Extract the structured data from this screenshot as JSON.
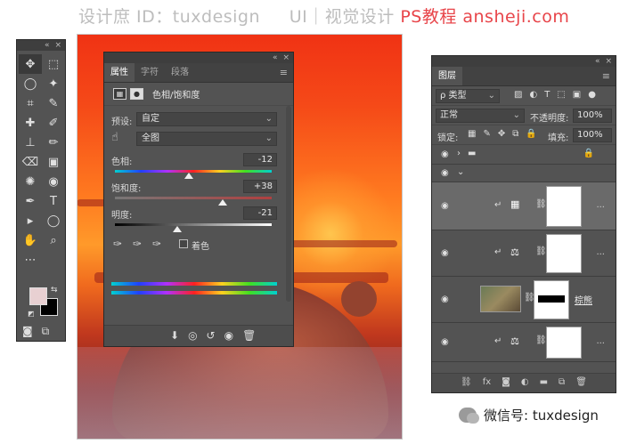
{
  "watermark": {
    "text": "设计庶 ID：tuxdesign",
    "brand": "UI｜视觉设计",
    "url": "PS教程 ansheji.com"
  },
  "toolbox": {
    "tools": [
      "✥",
      "⬚",
      "◯",
      "✦",
      "⌗",
      "✎",
      "✚",
      "✐",
      "⊥",
      "✏",
      "⌫",
      "▣",
      "✺",
      "◉",
      "✒",
      "T",
      "▸",
      "◯",
      "✋",
      "⌕",
      "⋯"
    ],
    "fg_color": "#e8d0d2",
    "bg_color": "#000000"
  },
  "properties": {
    "tabs": [
      "属性",
      "字符",
      "段落"
    ],
    "title": "色相/饱和度",
    "preset_label": "预设:",
    "preset_value": "自定",
    "channel_value": "全图",
    "hue_label": "色相:",
    "hue_value": "-12",
    "saturation_label": "饱和度:",
    "saturation_value": "+38",
    "lightness_label": "明度:",
    "lightness_value": "-21",
    "colorize_label": "着色",
    "hue_level": 0.47,
    "saturation_level": 0.69,
    "lightness_level": 0.4
  },
  "layers": {
    "tab": "图层",
    "filter_value": "ρ 类型",
    "blend_value": "正常",
    "opacity_label": "不透明度:",
    "opacity_value": "100%",
    "lock_label": "锁定:",
    "fill_label": "填充:",
    "fill_value": "100%",
    "rows": [
      {
        "kind": "group"
      },
      {
        "kind": "subgroup"
      },
      {
        "kind": "hue",
        "selected": true
      },
      {
        "kind": "balance"
      },
      {
        "kind": "photo",
        "name": "棕熊"
      },
      {
        "kind": "balance"
      }
    ]
  },
  "wechat": {
    "label": "微信号: tuxdesign"
  }
}
